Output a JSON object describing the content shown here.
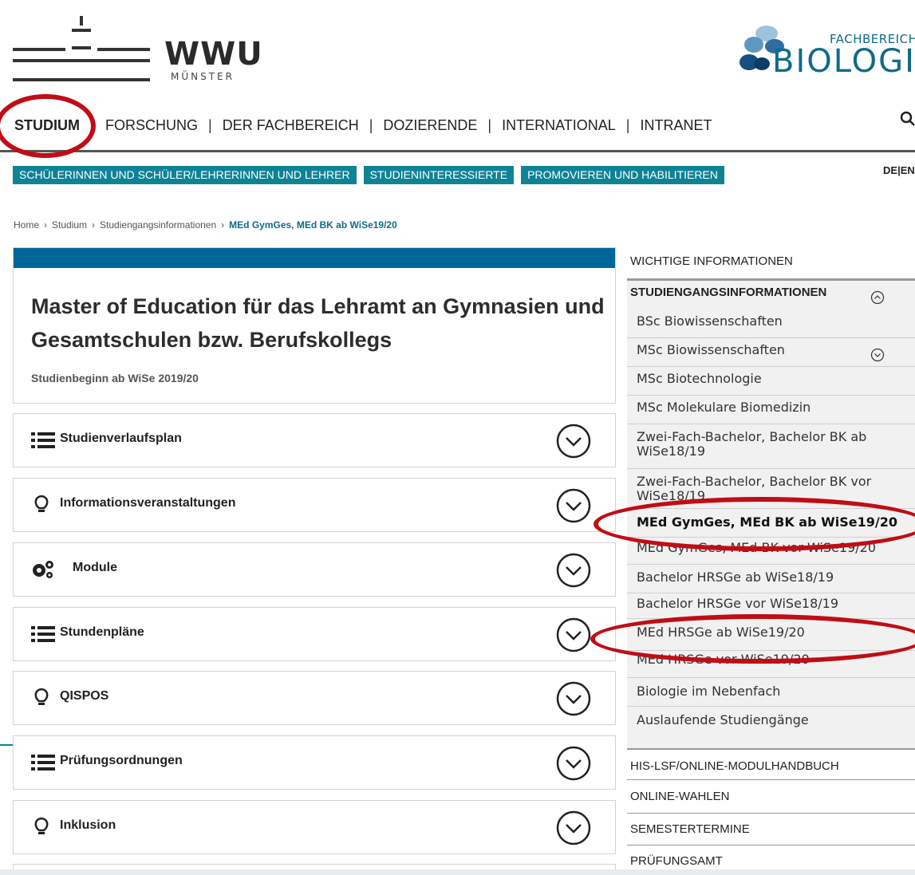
{
  "header": {
    "wwu_logo_text": "WWU",
    "wwu_logo_sub": "MÜNSTER",
    "faculty_label": "FACHBEREICH",
    "faculty_name": "BIOLOGIE"
  },
  "main_nav": {
    "items": [
      "STUDIUM",
      "FORSCHUNG",
      "DER FACHBEREICH",
      "DOZIERENDE",
      "INTERNATIONAL",
      "INTRANET"
    ],
    "active": "STUDIUM",
    "separator": "|"
  },
  "sub_nav": {
    "items": [
      "SCHÜLERINNEN UND SCHÜLER/LEHRERINNEN UND LEHRER",
      "STUDIENINTERESSIERTE",
      "PROMOVIEREN UND HABILITIEREN"
    ]
  },
  "language": {
    "de": "DE",
    "sep": "|",
    "en": "EN"
  },
  "breadcrumb": {
    "items": [
      "Home",
      "Studium",
      "Studiengangsinformationen"
    ],
    "current": "MEd GymGes, MEd BK ab WiSe19/20",
    "separator": "›"
  },
  "card": {
    "title": "Master of Education für das Lehramt an Gymnasien und Gesamtschulen bzw. Berufskollegs",
    "subtitle": "Studienbeginn ab WiSe 2019/20"
  },
  "accordions": [
    {
      "label": "Studienverlaufsplan",
      "icon": "list-icon"
    },
    {
      "label": "Informationsveranstaltungen",
      "icon": "lightbulb-icon"
    },
    {
      "label": "Module",
      "icon": "gears-icon"
    },
    {
      "label": "Stundenpläne",
      "icon": "list-icon"
    },
    {
      "label": "QISPOS",
      "icon": "lightbulb-icon"
    },
    {
      "label": "Prüfungsordnungen",
      "icon": "list-icon"
    },
    {
      "label": "Inklusion",
      "icon": "lightbulb-icon"
    }
  ],
  "sidebar": {
    "top_link": "WICHTIGE INFORMATIONEN",
    "section_title": "STUDIENGANGSINFORMATIONEN",
    "items": [
      "BSc Biowissenschaften",
      "MSc Biowissenschaften",
      "MSc Biotechnologie",
      "MSc Molekulare Biomedizin",
      "Zwei-Fach-Bachelor, Bachelor BK ab WiSe18/19",
      "Zwei-Fach-Bachelor, Bachelor BK vor WiSe18/19",
      "MEd GymGes, MEd BK ab WiSe19/20",
      "MEd GymGes, MEd BK vor WiSe19/20",
      "Bachelor HRSGe ab WiSe18/19",
      "Bachelor HRSGe vor WiSe18/19",
      "MEd HRSGe ab WiSe19/20",
      "MEd HRSGe vor WiSe19/20",
      "Biologie im Nebenfach",
      "Auslaufende Studiengänge"
    ],
    "active_item": "MEd GymGes, MEd BK ab WiSe19/20",
    "bottom_links": [
      "HIS-LSF/ONLINE-MODULHANDBUCH",
      "ONLINE-WAHLEN",
      "SEMESTERTERMINE",
      "PRÜFUNGSAMT"
    ]
  },
  "colors": {
    "teal": "#0f8396",
    "brand_blue": "#00669a",
    "annotation_red": "#c00d16"
  }
}
